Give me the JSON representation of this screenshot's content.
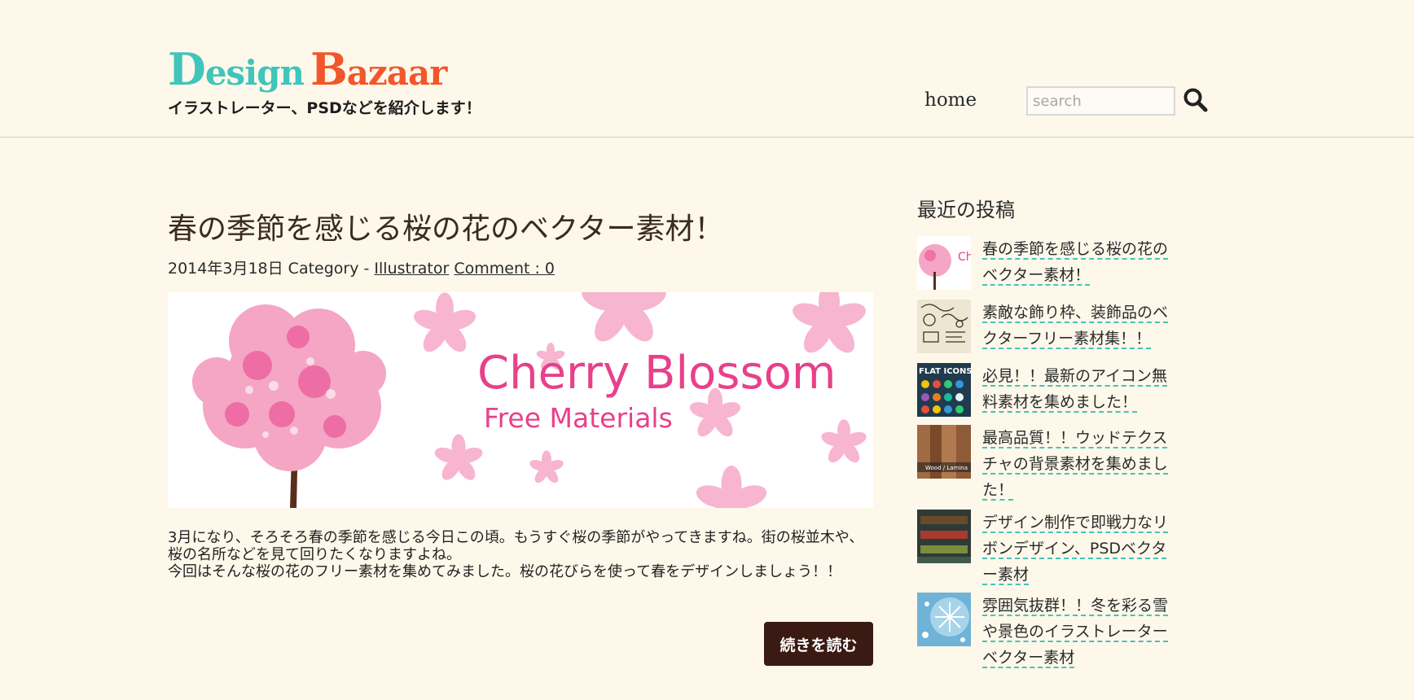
{
  "site": {
    "logo_word1_initial": "D",
    "logo_word1_rest": "esign",
    "logo_word2_initial": "B",
    "logo_word2_rest": "azaar",
    "tagline": "イラストレーター、PSDなどを紹介します！"
  },
  "nav": {
    "home": "home"
  },
  "search": {
    "placeholder": "search"
  },
  "post": {
    "title": "春の季節を感じる桜の花のベクター素材！",
    "date": "2014年3月18日",
    "category_prefix": "Category - ",
    "category": "Illustrator",
    "comments": "Comment : 0",
    "hero_title": "Cherry Blossom",
    "hero_subtitle": "Free Materials",
    "paragraph1": "3月になり、そろそろ春の季節を感じる今日この頃。もうすぐ桜の季節がやってきますね。街の桜並木や、桜の名所などを見て回りたくなりますよね。",
    "paragraph2": "今回はそんな桜の花のフリー素材を集めてみました。桜の花びらを使って春をデザインしましょう！！",
    "read_more": "続きを読む"
  },
  "sidebar": {
    "title": "最近の投稿",
    "items": [
      {
        "label": "春の季節を感じる桜の花のベクター素材！",
        "thumb_text": "Ch"
      },
      {
        "label": "素敵な飾り枠、装飾品のベクターフリー素材集！！"
      },
      {
        "label": "必見！！最新のアイコン無料素材を集めました！",
        "thumb_text": "FLAT ICONS"
      },
      {
        "label": "最高品質！！ウッドテクスチャの背景素材を集めました！",
        "thumb_text": "Wood / Lamina"
      },
      {
        "label": "デザイン制作で即戦力なリボンデザイン、PSDベクター素材"
      },
      {
        "label": "雰囲気抜群！！冬を彩る雪や景色のイラストレーターベクター素材"
      }
    ]
  },
  "colors": {
    "background": "#fdf8ea",
    "logo_teal": "#3fc5bb",
    "logo_orange": "#f2562b",
    "button_dark": "#3a1a12",
    "link_dash": "#45c3b8",
    "blossom_pink": "#e8408a"
  }
}
